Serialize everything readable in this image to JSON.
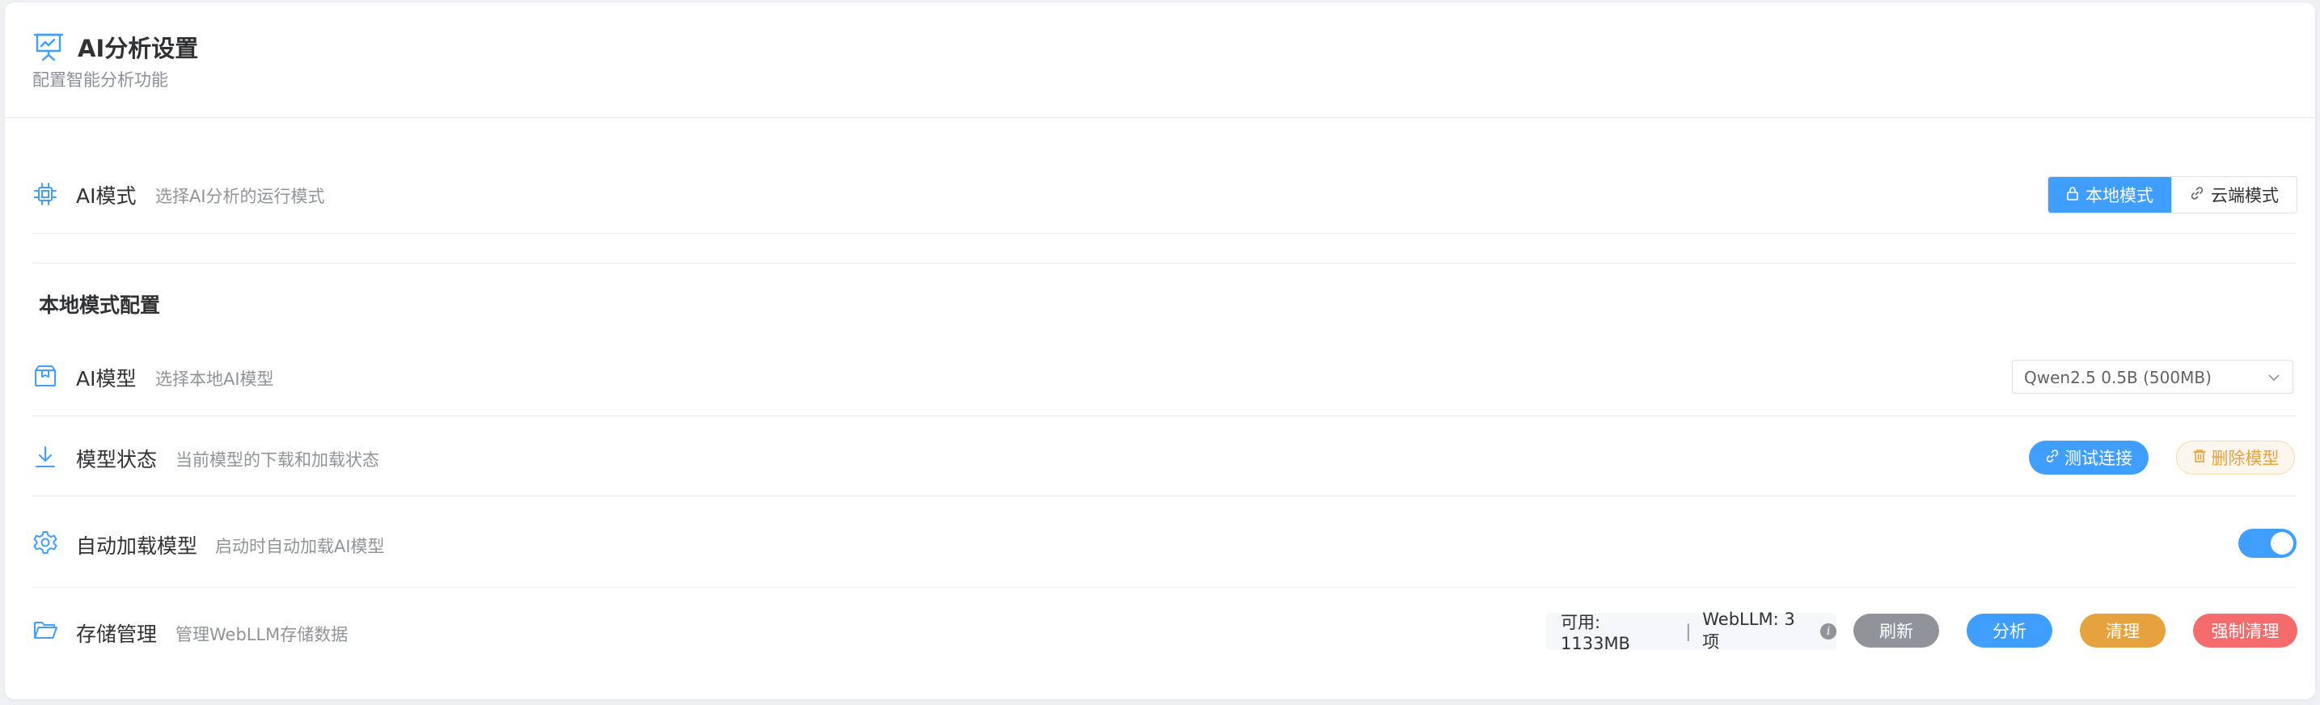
{
  "header": {
    "title": "AI分析设置",
    "subtitle": "配置智能分析功能",
    "icon": "presentation-chart-icon"
  },
  "ai_mode": {
    "label": "AI模式",
    "desc": "选择AI分析的运行模式",
    "icon": "cpu-icon",
    "options": [
      {
        "label": "本地模式",
        "icon": "lock-icon",
        "active": true
      },
      {
        "label": "云端模式",
        "icon": "link-icon",
        "active": false
      }
    ]
  },
  "local_section": {
    "title": "本地模式配置"
  },
  "model": {
    "label": "AI模型",
    "desc": "选择本地AI模型",
    "icon": "box-icon",
    "selected": "Qwen2.5 0.5B (500MB)"
  },
  "model_status": {
    "label": "模型状态",
    "desc": "当前模型的下载和加载状态",
    "icon": "download-icon",
    "test_label": "测试连接",
    "delete_label": "删除模型"
  },
  "auto_load": {
    "label": "自动加载模型",
    "desc": "启动时自动加载AI模型",
    "icon": "gear-icon",
    "enabled": true
  },
  "storage": {
    "label": "存储管理",
    "desc": "管理WebLLM存储数据",
    "icon": "folder-icon",
    "available": "可用: 1133MB",
    "separator": "|",
    "webllm": "WebLLM: 3项",
    "refresh_label": "刷新",
    "analyze_label": "分析",
    "clean_label": "清理",
    "force_clean_label": "强制清理"
  },
  "colors": {
    "primary": "#409eff",
    "warning": "#e6a23c",
    "danger": "#f56c6c",
    "info": "#909399"
  }
}
